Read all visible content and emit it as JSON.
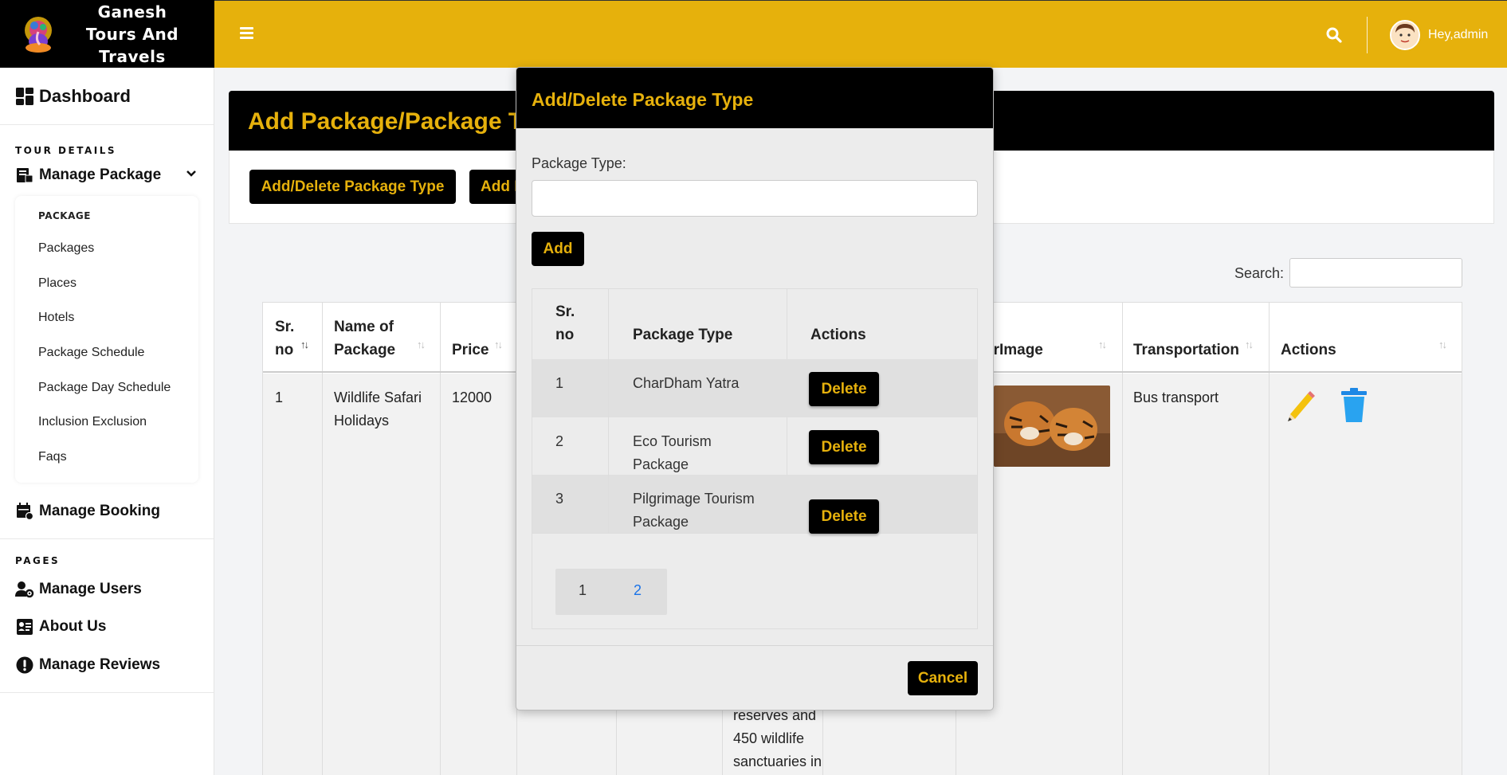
{
  "brand": {
    "name_line1": "Ganesh",
    "name_line2": "Tours And",
    "name_line3": "Travels"
  },
  "topbar": {
    "greeting": "Hey,admin"
  },
  "sidebar": {
    "dashboard": "Dashboard",
    "section_tour": "TOUR DETAILS",
    "manage_package": "Manage Package",
    "submenu_head": "PACKAGE",
    "submenu": [
      "Packages",
      "Places",
      "Hotels",
      "Package Schedule",
      "Package Day Schedule",
      "Inclusion Exclusion",
      "Faqs"
    ],
    "manage_booking": "Manage Booking",
    "section_pages": "PAGES",
    "manage_users": "Manage Users",
    "about_us": "About Us",
    "manage_reviews": "Manage Reviews"
  },
  "page": {
    "title": "Add Package/Package Ty",
    "btn_add_delete_type": "Add/Delete Package Type",
    "btn_add_package": "Add P",
    "search_label": "Search:"
  },
  "table": {
    "headers": {
      "srno_1": "Sr.",
      "srno_2": "no",
      "name_1": "Name of",
      "name_2": "Package",
      "price": "Price",
      "image": "erImage",
      "transport": "Transportation",
      "actions": "Actions"
    },
    "row": {
      "srno": "1",
      "name_1": "Wildlife Safari",
      "name_2": "Holidays",
      "price": "12000",
      "desc_1": "reserves and",
      "desc_2": "450 wildlife",
      "desc_3": "sanctuaries in",
      "transport": "Bus transport"
    }
  },
  "modal": {
    "title": "Add/Delete Package Type",
    "label": "Package Type:",
    "input_value": "",
    "add_button": "Add",
    "headers": {
      "srno_1": "Sr.",
      "srno_2": "no",
      "type": "Package Type",
      "actions": "Actions"
    },
    "rows": [
      {
        "srno": "1",
        "type_1": "CharDham Yatra",
        "type_2": "",
        "delete": "Delete"
      },
      {
        "srno": "2",
        "type_1": "Eco Tourism",
        "type_2": "Package",
        "delete": "Delete"
      },
      {
        "srno": "3",
        "type_1": "Pilgrimage Tourism",
        "type_2": "Package",
        "delete": "Delete"
      }
    ],
    "pagination": {
      "current": "1",
      "next": "2"
    },
    "cancel_button": "Cancel"
  },
  "colors": {
    "accent": "#e6b10c",
    "dark": "#000000",
    "link": "#1a73e8"
  }
}
